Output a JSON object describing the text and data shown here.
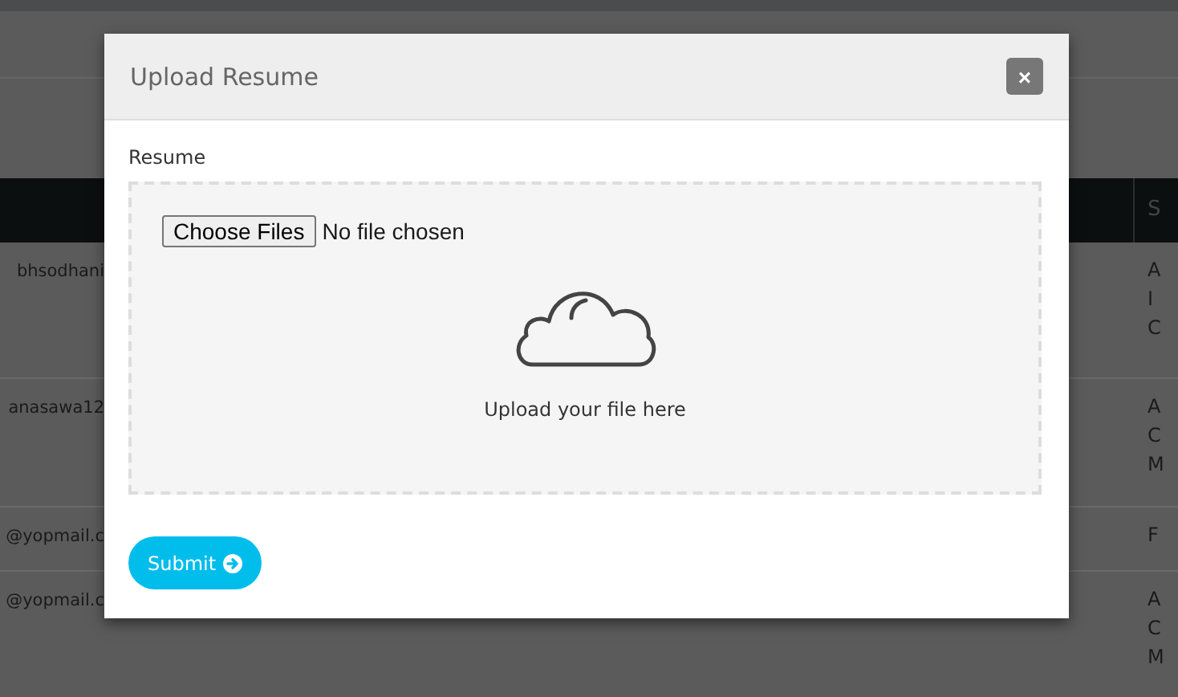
{
  "background_table": {
    "header": {
      "column_2": "S"
    },
    "rows": [
      {
        "column_1": "bhsodhani",
        "column_2": [
          "A",
          "I",
          "C"
        ]
      },
      {
        "column_1": "anasawa12",
        "column_2": [
          "A",
          "C",
          "M"
        ]
      },
      {
        "column_1": "@yopmail.c",
        "column_2": [
          "F"
        ]
      },
      {
        "column_1": "@yopmail.c",
        "column_2": [
          "A",
          "C",
          "M"
        ]
      }
    ]
  },
  "modal": {
    "title": "Upload Resume",
    "close": "×",
    "field_label": "Resume",
    "file_button": "Choose Files",
    "file_status": "No file chosen",
    "drop_text": "Upload your file here",
    "submit": "Submit"
  }
}
